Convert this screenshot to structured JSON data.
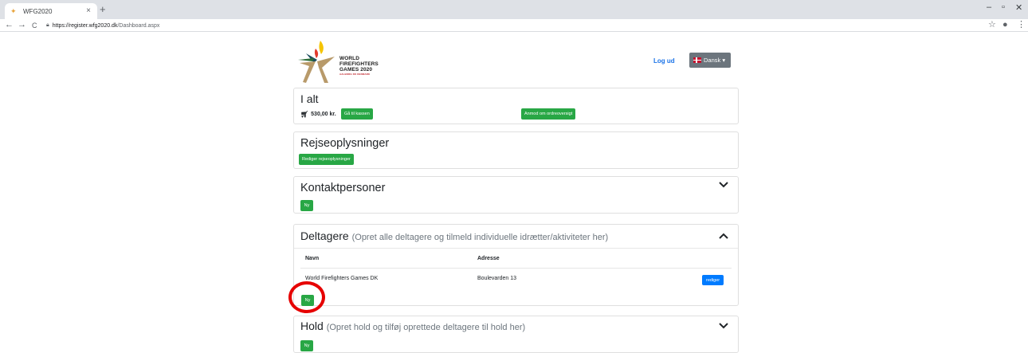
{
  "browser": {
    "tab_title": "WFG2020",
    "tab_close": "×",
    "new_tab": "+",
    "url_host": "https://register.wfg2020.dk",
    "url_path": "/Dashboard.aspx",
    "min": "–",
    "max": "▫",
    "close": "✕",
    "back": "←",
    "forward": "→",
    "reload": "C",
    "star": "☆",
    "account": "●",
    "menu": "⋮"
  },
  "header": {
    "logo_line1": "WORLD",
    "logo_line2": "FIREFIGHTERS",
    "logo_line3": "GAMES 2020",
    "logo_sub": "AALBORG DK DENMARK",
    "logout": "Log ud",
    "language": "Dansk ▾"
  },
  "total_card": {
    "title": "I alt",
    "amount": "530,00 kr.",
    "checkout_button": "Gå til kassen",
    "order_overview_button": "Anmod om ordreoversigt"
  },
  "travel_card": {
    "title": "Rejseoplysninger",
    "edit_button": "Rediger rejseoplysninger"
  },
  "contacts_card": {
    "title": "Kontaktpersoner",
    "new_button": "Ny"
  },
  "participants_card": {
    "title": "Deltagere",
    "description": "(Opret alle deltagere og tilmeld individuelle idrætter/aktiviteter her)",
    "col_name": "Navn",
    "col_address": "Adresse",
    "rows": [
      {
        "name": "World Firefighters Games DK",
        "address": "Boulevarden 13",
        "edit": "rediger"
      }
    ],
    "new_button": "Ny"
  },
  "teams_card": {
    "title": "Hold",
    "description": "(Opret hold og tilføj oprettede deltagere til hold her)",
    "new_button": "Ny"
  },
  "colors": {
    "green": "#28a745",
    "blue": "#007bff",
    "highlight": "#e60000"
  }
}
